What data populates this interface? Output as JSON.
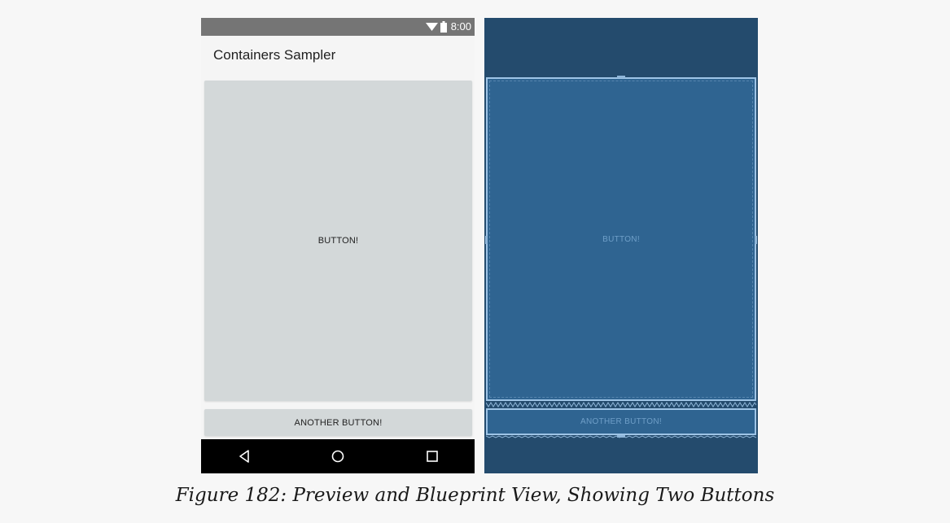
{
  "preview": {
    "status_bar": {
      "time": "8:00",
      "icons": [
        "wifi-icon",
        "battery-icon"
      ]
    },
    "app_title": "Containers Sampler",
    "big_button_label": "BUTTON!",
    "small_button_label": "ANOTHER BUTTON!",
    "nav_bar": {
      "icons": [
        "back-icon",
        "home-icon",
        "recents-icon"
      ]
    }
  },
  "blueprint": {
    "big_button_label": "BUTTON!",
    "small_button_label": "ANOTHER BUTTON!"
  },
  "caption": "Figure 182: Preview and Blueprint View, Showing Two Buttons",
  "colors": {
    "status_bar": "#757575",
    "button": "#d3d8d9",
    "blueprint_bg": "#244b6d",
    "blueprint_view": "#2f6491",
    "blueprint_outline": "#9ec4e6"
  }
}
